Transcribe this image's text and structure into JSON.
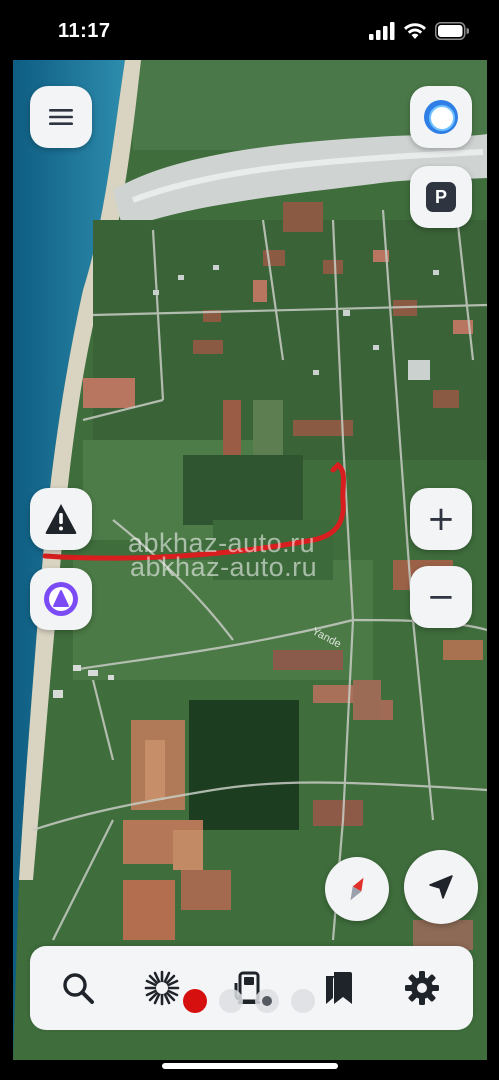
{
  "status_bar": {
    "time": "11:17"
  },
  "map": {
    "watermark_text": "abkhaz-auto.ru",
    "road_label": "Yande"
  },
  "controls": {
    "menu": "menu-icon",
    "alice_top": "alice-icon",
    "parking": "P",
    "warning": "warning-icon",
    "alice_left": "alice-icon",
    "zoom_in": "+",
    "zoom_out": "−",
    "compass": "compass-icon",
    "locate": "navigation-arrow-icon"
  },
  "bottom_nav": {
    "items": [
      {
        "icon": "search-icon"
      },
      {
        "icon": "burst-icon"
      },
      {
        "icon": "fuel-icon"
      },
      {
        "icon": "bookmarks-icon"
      },
      {
        "icon": "settings-icon"
      }
    ],
    "page_dots": 4,
    "active_page": 1
  },
  "colors": {
    "route": "#d81e1e",
    "sea": "#1c6e92",
    "button_bg": "#f3f4f6",
    "icon_dark": "#2e3440",
    "alice": "#7b4cf5",
    "compass_red": "#e0322a",
    "active_dot": "#d60f0f"
  }
}
